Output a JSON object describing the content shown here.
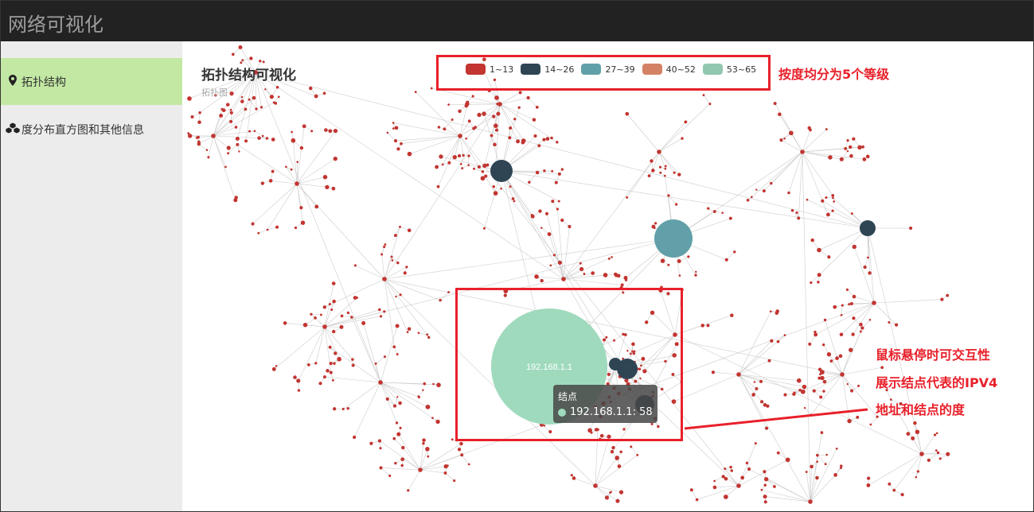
{
  "app": {
    "title": "网络可视化"
  },
  "sidebar": {
    "items": [
      {
        "label": "拓扑结构",
        "icon": "map-marker-icon",
        "active": true
      },
      {
        "label": "度分布直方图和其他信息",
        "icon": "cubes-icon",
        "active": false
      }
    ]
  },
  "chart": {
    "title": "拓扑结构可视化",
    "subtitle": "拓扑图"
  },
  "legend": [
    {
      "label": "1~13",
      "color": "#c23531"
    },
    {
      "label": "14~26",
      "color": "#2f4554"
    },
    {
      "label": "27~39",
      "color": "#61a0a8"
    },
    {
      "label": "40~52",
      "color": "#d48265"
    },
    {
      "label": "53~65",
      "color": "#91c7ae"
    }
  ],
  "hub": {
    "label": "192.168.1.1",
    "color": "#9fdabd"
  },
  "tooltip": {
    "title": "结点",
    "value": "192.168.1.1: 58"
  },
  "annotations": {
    "legend_note": "按度均分为5个等级",
    "hover_note_1": "鼠标悬停时可交互性",
    "hover_note_2": "展示结点代表的IPV4",
    "hover_note_3": "地址和结点的度"
  },
  "colors": {
    "node": "#c23531",
    "edge": "#cccccc",
    "annotation": "#e8202a"
  }
}
